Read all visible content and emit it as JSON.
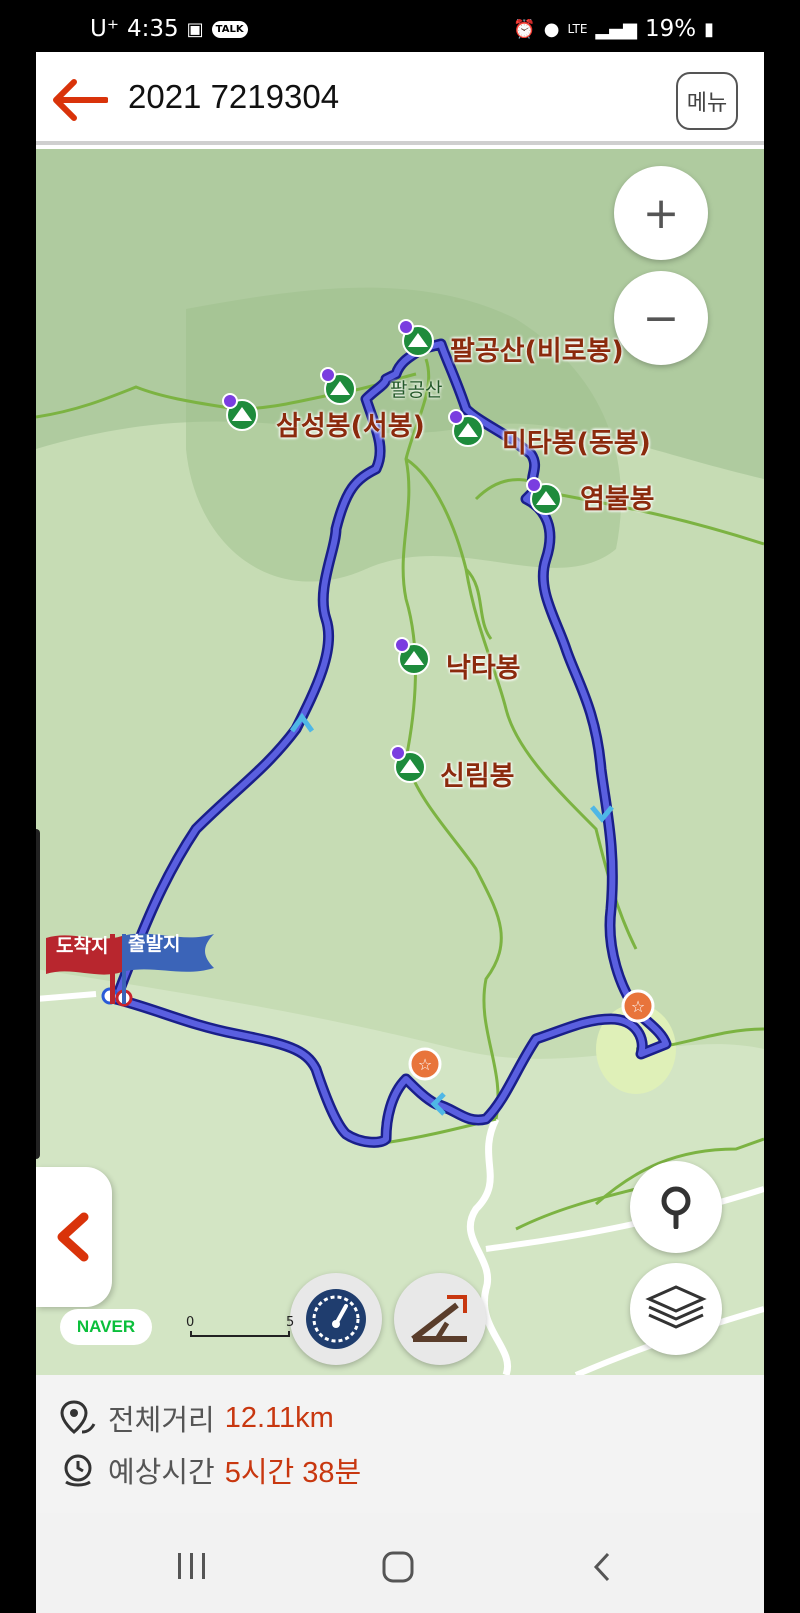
{
  "status_bar": {
    "carrier": "U⁺",
    "time": "4:35",
    "talk_badge": "TALK",
    "network": "LTE",
    "battery": "19%"
  },
  "header": {
    "title": "2021 7219304",
    "menu_label": "메뉴"
  },
  "map": {
    "peaks": [
      {
        "name": "팔공산(비로봉)"
      },
      {
        "name": "삼성봉(서봉)"
      },
      {
        "name": "미타봉(동봉)"
      },
      {
        "name": "염불봉"
      },
      {
        "name": "낙타봉"
      },
      {
        "name": "신림봉"
      }
    ],
    "area_label": "팔공산",
    "flag_end": "도착지",
    "flag_start": "출발지",
    "logo": "NAVER",
    "scale_start": "0",
    "scale_end": "5",
    "zoom_in": "+",
    "zoom_out": "−",
    "route_color": "#4a4fd0",
    "trail_color": "#7cb342"
  },
  "summary": {
    "distance_label": "전체거리",
    "distance_value": "12.11km",
    "time_label": "예상시간",
    "time_value": "5시간 38분"
  }
}
